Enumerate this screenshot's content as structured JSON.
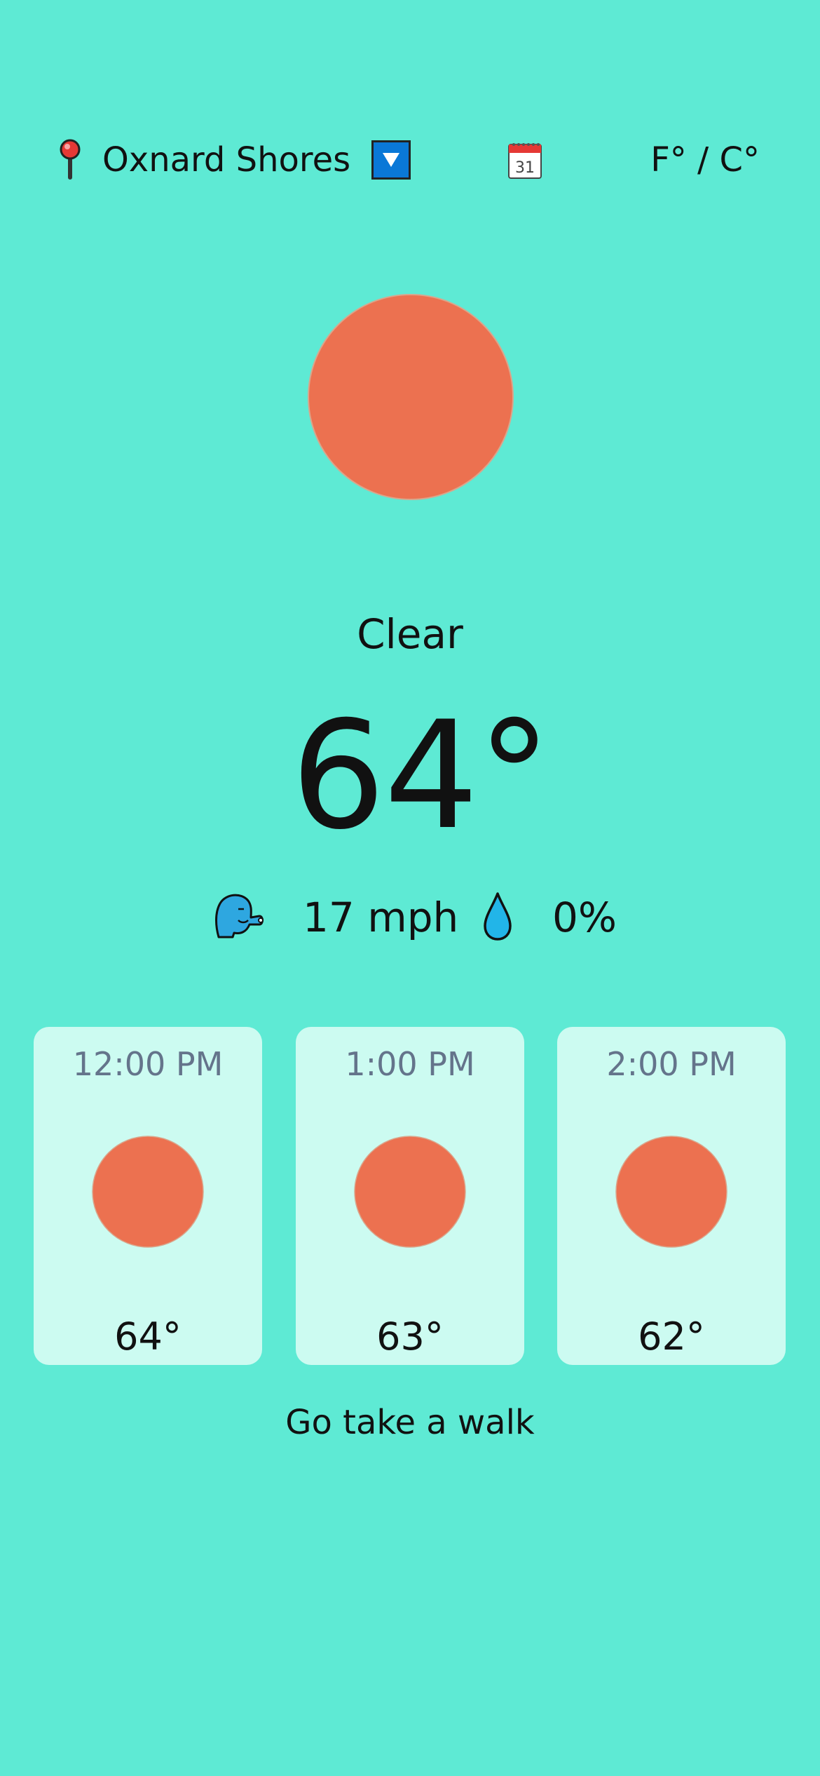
{
  "header": {
    "location": "Oxnard Shores",
    "unit_toggle": "F° / C°",
    "icons": [
      "pin-icon",
      "dropdown-arrow-icon",
      "calendar-icon"
    ],
    "calendar_day": "31"
  },
  "current": {
    "condition": "Clear",
    "temperature": "64°",
    "wind": "17 mph",
    "precipitation": "0%",
    "icons": [
      "sun-icon",
      "wind-face-icon",
      "droplet-icon"
    ]
  },
  "hourly": [
    {
      "time": "12:00 PM",
      "temp": "64°",
      "icon": "sun-icon"
    },
    {
      "time": "1:00 PM",
      "temp": "63°",
      "icon": "sun-icon"
    },
    {
      "time": "2:00 PM",
      "temp": "62°",
      "icon": "sun-icon"
    }
  ],
  "tip": "Go take a walk",
  "colors": {
    "background": "#5EEAD4",
    "card": "#CCFBF1",
    "sun": "#EC7150",
    "dropdown": "#0A78D7"
  }
}
